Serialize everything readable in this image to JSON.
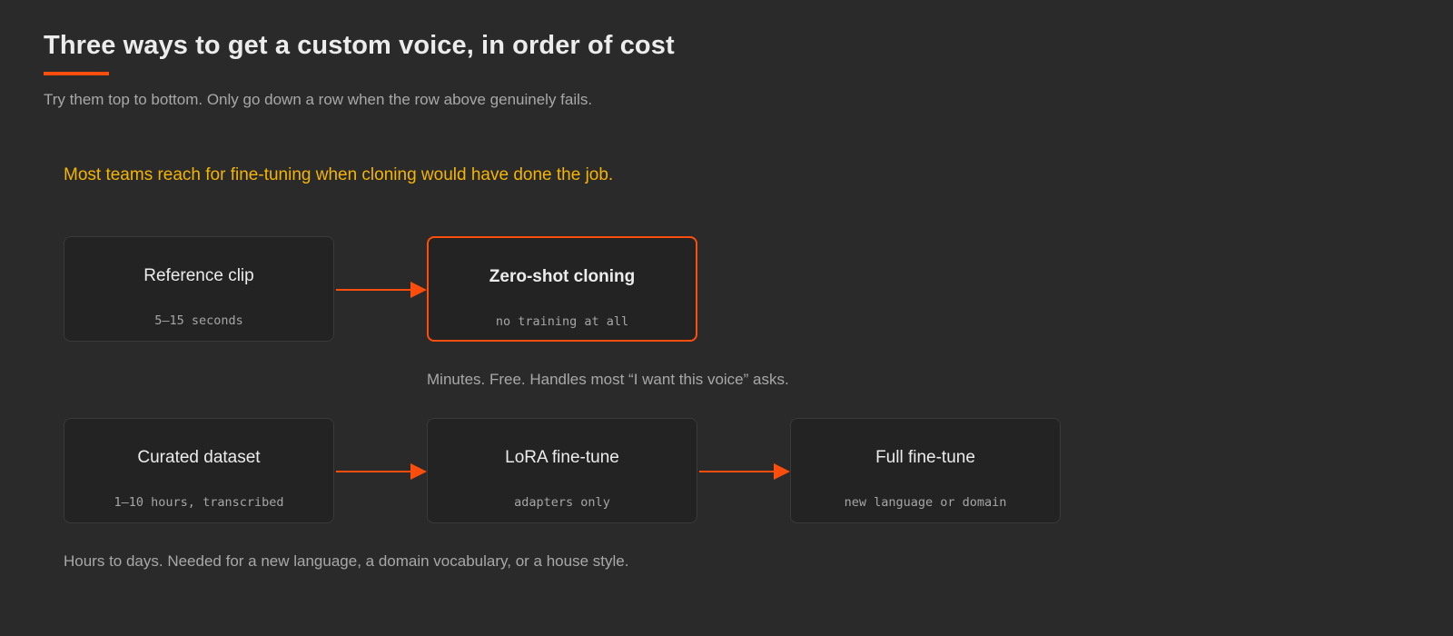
{
  "header": {
    "title": "Three ways to get a custom voice, in order of cost",
    "subtitle": "Try them top to bottom. Only go down a row when the row above genuinely fails."
  },
  "callout": "Most teams reach for fine-tuning when cloning would have done the job.",
  "rows": [
    {
      "nodes": [
        {
          "title": "Reference clip",
          "sub": "5–15 seconds"
        },
        {
          "title": "Zero-shot cloning",
          "sub": "no training at all",
          "highlighted": true
        }
      ],
      "note": "Minutes. Free. Handles most “I want this voice” asks."
    },
    {
      "nodes": [
        {
          "title": "Curated dataset",
          "sub": "1–10 hours, transcribed"
        },
        {
          "title": "LoRA fine-tune",
          "sub": "adapters only"
        },
        {
          "title": "Full fine-tune",
          "sub": "new language or domain"
        }
      ],
      "note": "Hours to days. Needed for a new language, a domain vocabulary, or a house style."
    }
  ],
  "colors": {
    "accent": "#ff4d0d",
    "callout": "#f5b400",
    "background": "#2a2a2a"
  }
}
